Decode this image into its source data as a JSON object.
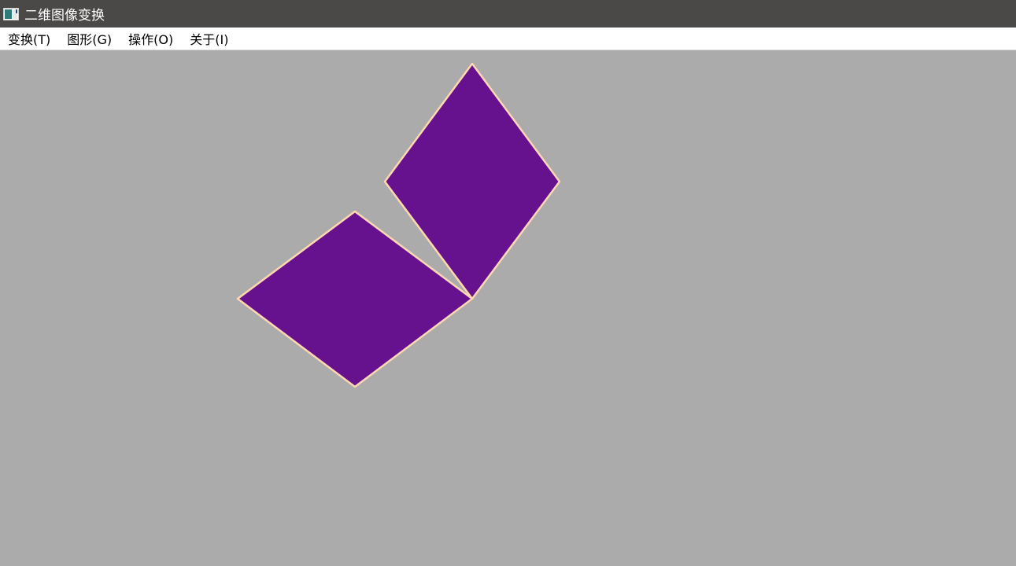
{
  "window": {
    "title": "二维图像变换",
    "icon": "app-window-icon"
  },
  "menubar": {
    "items": [
      {
        "label": "变换(T)"
      },
      {
        "label": "图形(G)"
      },
      {
        "label": "操作(O)"
      },
      {
        "label": "关于(I)"
      }
    ]
  },
  "canvas": {
    "background_color": "#ababab",
    "shape_fill_color": "#66128f",
    "shape_outline_color": "#ffd7b0",
    "shapes": [
      {
        "name": "rhombus-upper"
      },
      {
        "name": "rhombus-lower"
      }
    ]
  }
}
